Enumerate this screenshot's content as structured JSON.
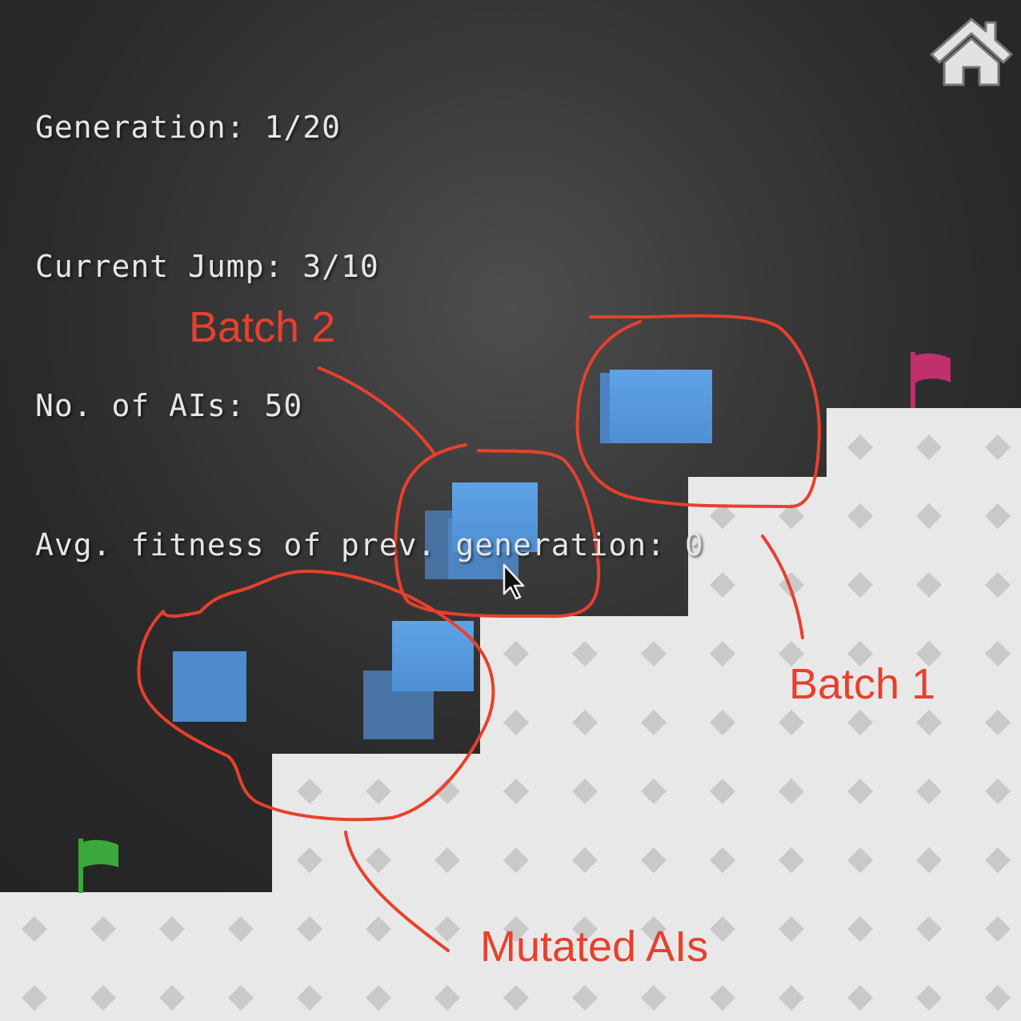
{
  "hud": {
    "generation": "Generation: 1/20",
    "current_jump": "Current Jump: 3/10",
    "ai_count": "No. of AIs: 50",
    "avg_fitness": "Avg. fitness of prev. generation: 0"
  },
  "annotations": {
    "batch_2": "Batch 2",
    "batch_1": "Batch 1",
    "mutated": "Mutated AIs"
  },
  "icons": {
    "home": "home-icon",
    "start_flag": "flag-icon",
    "goal_flag": "flag-icon",
    "cursor": "mouse-pointer-icon"
  },
  "colors": {
    "background": "#2a2a2a",
    "ground": "#e8e8e8",
    "ground_diamond": "#c9c9c9",
    "ai_block": "#5a9be0",
    "ai_block_dim": "#4a78ad",
    "start_flag": "#3aa83a",
    "goal_flag": "#c0306a",
    "annotation": "#e8402c",
    "hud_text": "#e6e6e6"
  }
}
